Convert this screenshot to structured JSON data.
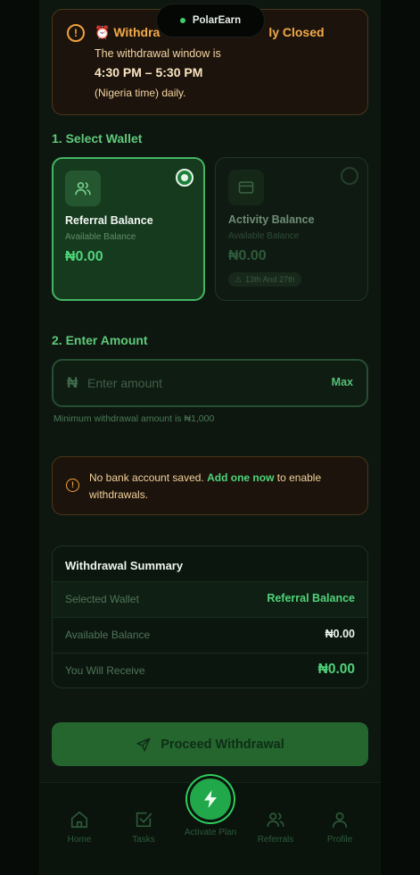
{
  "app": {
    "name": "PolarEarn"
  },
  "notice": {
    "title_left": "⏰ Withdra",
    "title_right": "ly Closed",
    "line1": "The withdrawal window is",
    "line2": "4:30 PM – 5:30 PM",
    "line3": "(Nigeria time) daily."
  },
  "select_wallet": {
    "heading": "1. Select Wallet",
    "wallets": [
      {
        "name": "Referral Balance",
        "sub": "Available Balance",
        "amount": "₦0.00",
        "selected": true,
        "icon": "users-icon"
      },
      {
        "name": "Activity Balance",
        "sub": "Available Balance",
        "amount": "₦0.00",
        "selected": false,
        "badge": "13th And 27th",
        "icon": "card-icon"
      }
    ]
  },
  "enter_amount": {
    "heading": "2. Enter Amount",
    "currency": "₦",
    "placeholder": "Enter amount",
    "max_label": "Max",
    "min_note": "Minimum withdrawal amount is ₦1,000"
  },
  "bank_alert": {
    "text_before": "No bank account saved. ",
    "link": "Add one now",
    "text_after": " to enable withdrawals."
  },
  "summary": {
    "title": "Withdrawal Summary",
    "rows": [
      {
        "label": "Selected Wallet",
        "value": "Referral Balance"
      },
      {
        "label": "Available Balance",
        "value": "₦0.00"
      },
      {
        "label": "You Will Receive",
        "value": "₦0.00"
      }
    ]
  },
  "proceed_label": "Proceed Withdrawal",
  "nav": {
    "items": [
      "Home",
      "Tasks",
      "Activate Plan",
      "Referrals",
      "Profile"
    ]
  },
  "colors": {
    "accent": "#4fd37a",
    "warning": "#f0a23c",
    "background": "#0d1710"
  }
}
